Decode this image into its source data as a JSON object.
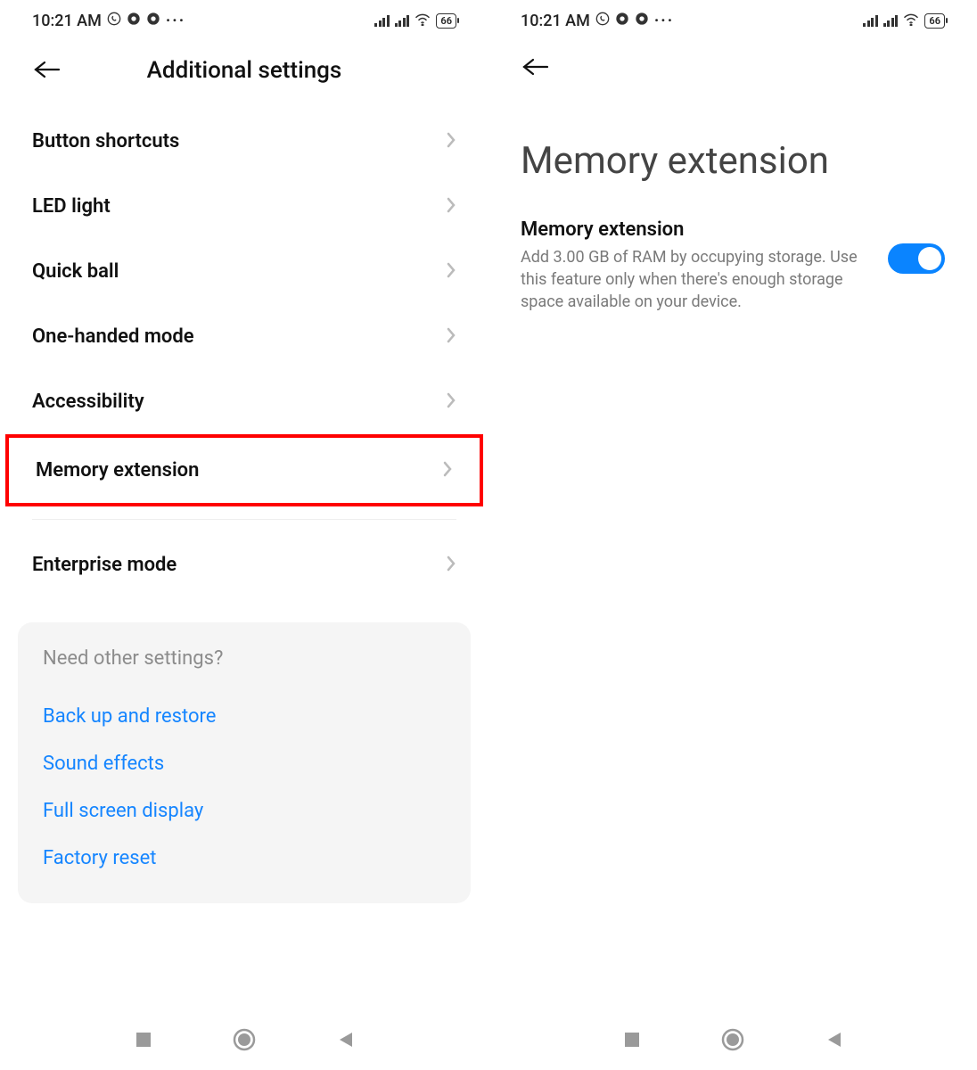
{
  "status": {
    "time": "10:21 AM",
    "battery": "66"
  },
  "left_screen": {
    "title": "Additional settings",
    "items": [
      "Button shortcuts",
      "LED light",
      "Quick ball",
      "One-handed mode",
      "Accessibility",
      "Memory extension"
    ],
    "after_divider_items": [
      "Enterprise mode"
    ],
    "highlighted_index": 5,
    "suggestions": {
      "title": "Need other settings?",
      "links": [
        "Back up and restore",
        "Sound effects",
        "Full screen display",
        "Factory reset"
      ]
    }
  },
  "right_screen": {
    "page_title": "Memory extension",
    "setting_title": "Memory extension",
    "setting_description": "Add 3.00 GB of RAM by occupying storage. Use this feature only when there's enough storage space available on your device.",
    "toggle_on": true
  }
}
